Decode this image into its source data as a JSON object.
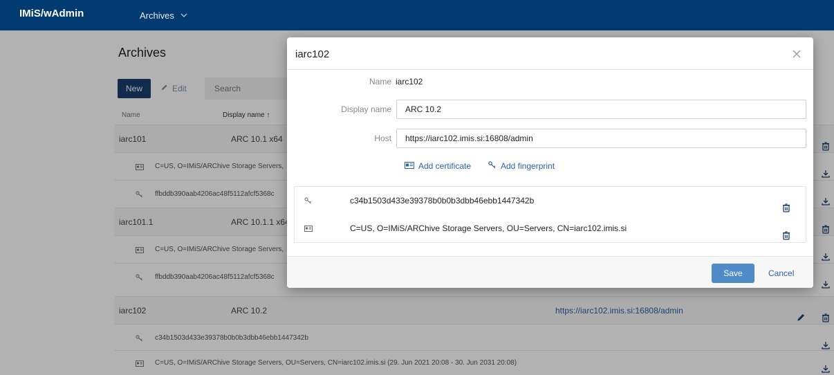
{
  "app": {
    "brand": "IMiS/wAdmin",
    "nav_menu": "Archives"
  },
  "page": {
    "title": "Archives",
    "toolbar": {
      "new_label": "New",
      "edit_label": "Edit",
      "search_placeholder": "Search"
    },
    "columns": {
      "name": "Name",
      "display_name": "Display name ↑"
    },
    "rows": {
      "r1": {
        "name": "iarc101",
        "display": "ARC 10.1 x64"
      },
      "r1_cert": {
        "text": "C=US, O=IMiS/ARChive Storage Servers,"
      },
      "r1_fp": {
        "text": "ffbddb390aab4206ac48f5112afcf5368c"
      },
      "r2": {
        "name": "iarc101.1",
        "display": "ARC 10.1.1 x64"
      },
      "r2_cert": {
        "text": "C=US, O=IMiS/ARChive Storage Servers,"
      },
      "r2_fp": {
        "text": "ffbddb390aab4206ac48f5112afcf5368c"
      },
      "r3": {
        "name": "iarc102",
        "display": "ARC 10.2",
        "host": "https://iarc102.imis.si:16808/admin"
      },
      "r3_fp": {
        "text": "c34b1503d433e39378b0b0b3dbb46ebb1447342b"
      },
      "r3_cert": {
        "text": "C=US, O=IMiS/ARChive Storage Servers, OU=Servers, CN=iarc102.imis.si (29. Jun 2021 20:08 - 30. Jun 2031 20:08)"
      }
    }
  },
  "modal": {
    "title": "iarc102",
    "name_label": "Name",
    "name_value": "iarc102",
    "display_label": "Display name",
    "display_value": "ARC 10.2",
    "host_label": "Host",
    "host_value": "https://iarc102.imis.si:16808/admin",
    "add_certificate": "Add certificate",
    "add_fingerprint": "Add fingerprint",
    "items": {
      "fingerprint": "c34b1503d433e39378b0b0b3dbb46ebb1447342b",
      "certificate": "C=US, O=IMiS/ARChive Storage Servers, OU=Servers, CN=iarc102.imis.si"
    },
    "save_label": "Save",
    "cancel_label": "Cancel"
  },
  "colors": {
    "topbar": "#003a70",
    "primary": "#1a3d6d",
    "save": "#4f8bc9",
    "link": "#2c5fa6"
  },
  "icons": [
    "chevron-down-icon",
    "pencil-icon",
    "trash-icon",
    "download-icon",
    "certificate-icon",
    "key-icon",
    "close-icon"
  ]
}
